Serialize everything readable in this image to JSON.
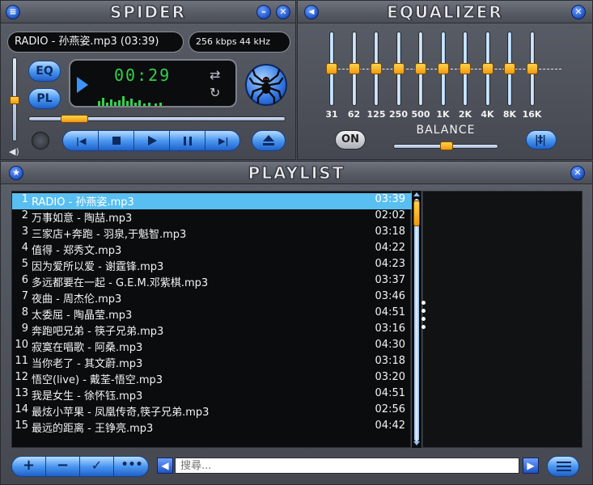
{
  "player": {
    "title": "SPIDER",
    "track_display": "RADIO - 孙燕姿.mp3 (03:39)",
    "bitrate_display": "256 kbps 44 kHz",
    "time": "00:29",
    "eq_button": "EQ",
    "pl_button": "PL",
    "progress": 0.12,
    "volume": 0.5
  },
  "equalizer": {
    "title": "EQUALIZER",
    "bands": [
      "31",
      "62",
      "125",
      "250",
      "500",
      "1K",
      "2K",
      "4K",
      "8K",
      "16K"
    ],
    "on_label": "ON",
    "balance_label": "BALANCE"
  },
  "playlist": {
    "title": "PLAYLIST",
    "selected_index": 0,
    "tracks": [
      {
        "num": "1",
        "name": "RADIO - 孙燕姿.mp3",
        "duration": "03:39"
      },
      {
        "num": "2",
        "name": "万事如意 - 陶喆.mp3",
        "duration": "02:02"
      },
      {
        "num": "3",
        "name": "三家店+奔跑 - 羽泉,于魁智.mp3",
        "duration": "03:18"
      },
      {
        "num": "4",
        "name": "值得 - 郑秀文.mp3",
        "duration": "04:22"
      },
      {
        "num": "5",
        "name": "因为爱所以爱 - 谢霆锋.mp3",
        "duration": "04:23"
      },
      {
        "num": "6",
        "name": "多远都要在一起 - G.E.M.邓紫棋.mp3",
        "duration": "03:37"
      },
      {
        "num": "7",
        "name": "夜曲 - 周杰伦.mp3",
        "duration": "03:46"
      },
      {
        "num": "8",
        "name": "太委屈 - 陶晶莹.mp3",
        "duration": "04:51"
      },
      {
        "num": "9",
        "name": "奔跑吧兄弟 - 筷子兄弟.mp3",
        "duration": "03:16"
      },
      {
        "num": "10",
        "name": "寂寞在唱歌 - 阿桑.mp3",
        "duration": "04:30"
      },
      {
        "num": "11",
        "name": "当你老了 - 其文蔚.mp3",
        "duration": "03:18"
      },
      {
        "num": "12",
        "name": "悟空(live) - 戴荃-悟空.mp3",
        "duration": "03:20"
      },
      {
        "num": "13",
        "name": "我是女生 - 徐怀钰.mp3",
        "duration": "04:51"
      },
      {
        "num": "14",
        "name": "最炫小苹果 - 凤凰传奇,筷子兄弟.mp3",
        "duration": "02:56"
      },
      {
        "num": "15",
        "name": "最远的距离 - 王铮亮.mp3",
        "duration": "04:42"
      }
    ],
    "search_placeholder": "搜尋..."
  },
  "colors": {
    "accent_blue": "#2f74e0",
    "lcd_green": "#32d14a",
    "selection": "#59bff1",
    "knob_orange": "#f5a81c"
  }
}
